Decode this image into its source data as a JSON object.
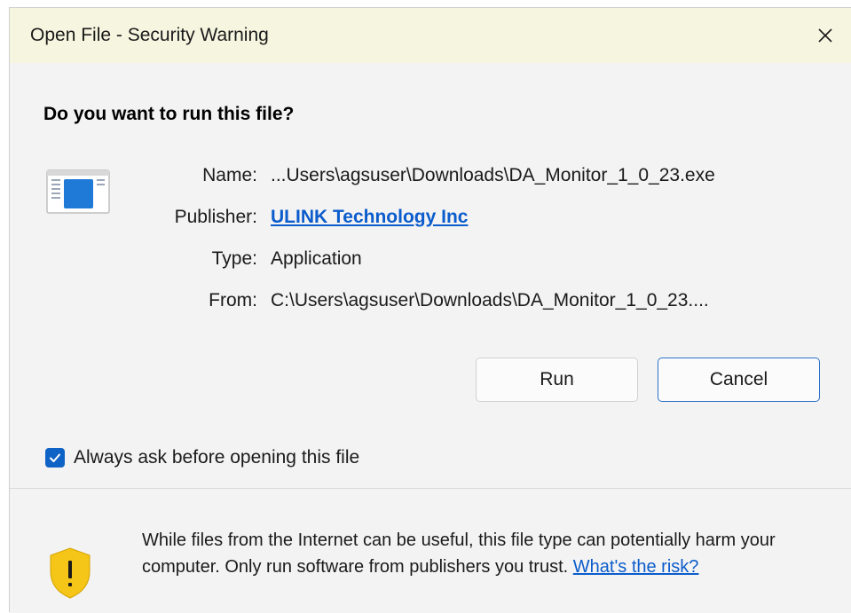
{
  "window": {
    "title": "Open File - Security Warning",
    "close_icon": "close-icon"
  },
  "heading": "Do you want to run this file?",
  "file_info": {
    "icon": "application-window-icon",
    "name_label": "Name:",
    "name_value": "...Users\\agsuser\\Downloads\\DA_Monitor_1_0_23.exe",
    "publisher_label": "Publisher:",
    "publisher_value": "ULINK Technology Inc",
    "type_label": "Type:",
    "type_value": "Application",
    "from_label": "From:",
    "from_value": "C:\\Users\\agsuser\\Downloads\\DA_Monitor_1_0_23...."
  },
  "buttons": {
    "run_label": "Run",
    "cancel_label": "Cancel"
  },
  "checkbox": {
    "label": "Always ask before opening this file",
    "checked": true
  },
  "warning": {
    "icon": "shield-warning-icon",
    "text": "While files from the Internet can be useful, this file type can potentially harm your computer. Only run software from publishers you trust.",
    "link_text": "What's the risk?"
  },
  "colors": {
    "title_bar_bg": "#f6f6e0",
    "dialog_bg": "#f3f3f3",
    "link": "#0b5ccc",
    "checkbox_accent": "#1063c6",
    "shield_yellow": "#f5c518"
  }
}
